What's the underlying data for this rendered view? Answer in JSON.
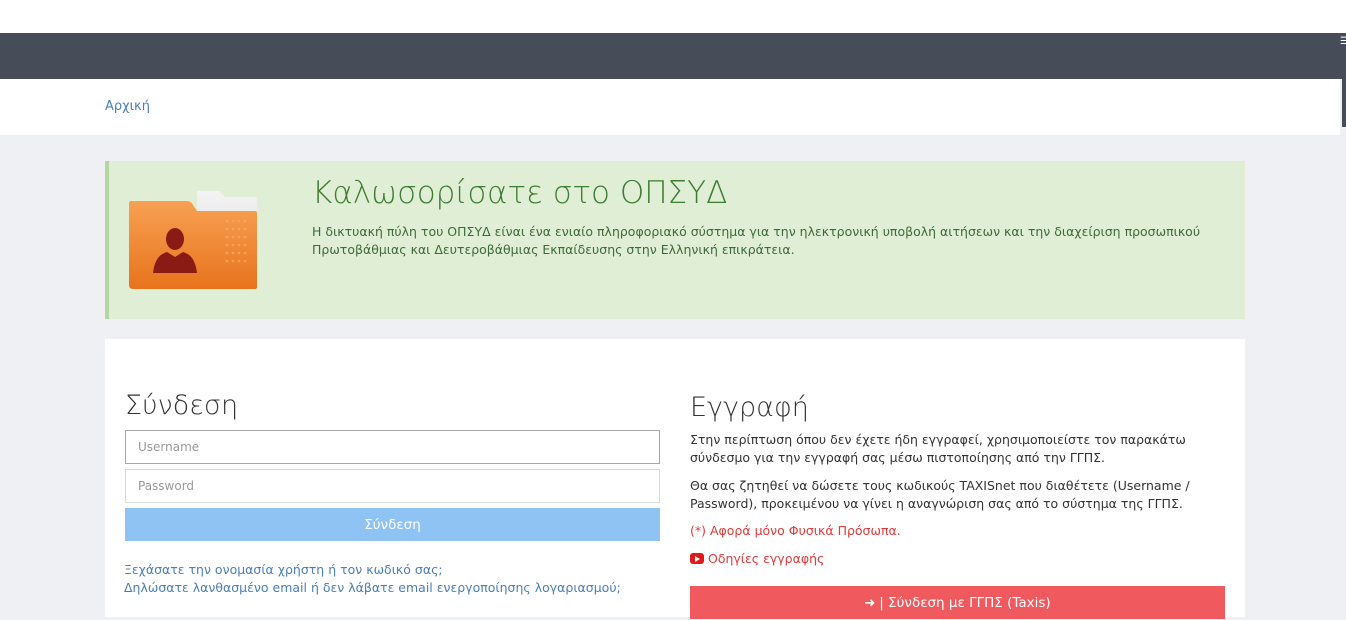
{
  "navbar": {
    "menu_icon": "menu-icon"
  },
  "breadcrumb": {
    "home": "Αρχική"
  },
  "welcome": {
    "title": "Καλωσορίσατε στο ΟΠΣΥΔ",
    "text": "Η δικτυακή πύλη του ΟΠΣΥΔ είναι ένα ενιαίο πληροφοριακό σύστημα για την ηλεκτρονική υποβολή αιτήσεων και την διαχείριση προσωπικού Πρωτοβάθμιας και Δευτεροβάθμιας Εκπαίδευσης στην Ελληνική επικράτεια.",
    "icon": "folder-user-icon"
  },
  "login": {
    "title": "Σύνδεση",
    "username_placeholder": "Username",
    "password_placeholder": "Password",
    "button_label": "Σύνδεση",
    "forgot_link": "Ξεχάσατε την ονομασία χρήστη ή τον κωδικό σας;",
    "wrong_email_link": "Δηλώσατε λανθασμένο email ή δεν λάβατε email ενεργοποίησης λογαριασμού;"
  },
  "register": {
    "title": "Εγγραφή",
    "p1": "Στην περίπτωση όπου δεν έχετε ήδη εγγραφεί, χρησιμοποιείστε τον παρακάτω σύνδεσμο για την εγγραφή σας μέσω πιστοποίησης από την ΓΓΠΣ.",
    "p2": "Θα σας ζητηθεί να δώσετε τους κωδικούς TAXISnet που διαθέτετε (Username / Password), προκειμένου να γίνει η αναγνώριση σας από το σύστημα της ΓΓΠΣ.",
    "note": "(*) Αφορά μόνο Φυσικά Πρόσωπα.",
    "guide_link": "Οδηγίες εγγραφής",
    "taxis_button": "| Σύνδεση με ΓΓΠΣ (Taxis)"
  },
  "colors": {
    "navbar": "#464c58",
    "welcome_bg": "#dfeed5",
    "login_button": "#8ec3f4",
    "taxis_button": "#f05a5e",
    "link": "#4a7fb5",
    "alert_red": "#e03a3a"
  }
}
